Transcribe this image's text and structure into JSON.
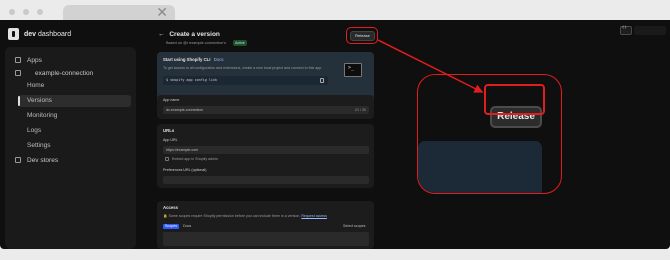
{
  "app": {
    "brand_bold": "dev",
    "brand_rest": " dashboard"
  },
  "sidebar": {
    "items": [
      {
        "label": "Apps",
        "icon": "apps-icon"
      },
      {
        "label": "example-connection",
        "icon": "app-icon"
      },
      {
        "label": "Home"
      },
      {
        "label": "Versions"
      },
      {
        "label": "Monitoring"
      },
      {
        "label": "Logs"
      },
      {
        "label": "Settings"
      },
      {
        "label": "Dev stores",
        "icon": "store-icon"
      }
    ]
  },
  "main": {
    "back_arrow": "←",
    "title": "Create a version",
    "subtitle": "Based on @r example-connection's",
    "badge": "Active",
    "release_label": "Release",
    "cli_card": {
      "title": "Start using Shopify CLI",
      "link": "Docs",
      "text": "To get access to all configuration and extensions, create a new local project and connect to this app.",
      "command": "$ shopify app config link"
    },
    "app_name": {
      "label": "App name",
      "value": "dv-example-connection",
      "counter": "21 / 30"
    },
    "urls": {
      "title": "URLs",
      "app_url_label": "App URL",
      "app_url_value": "https://example.com",
      "embed_label": "Embed app in Shopify admin",
      "preferences_label": "Preferences URL (optional)"
    },
    "access": {
      "title": "Access",
      "text": "Some scopes require Shopify permission before you can include them in a version.",
      "link": "Request access",
      "tab_scopes": "Scopes",
      "tab_docs": "Docs",
      "select_scopes": "Select scopes"
    }
  },
  "zoom": {
    "release_label": "Release"
  },
  "colors": {
    "highlight": "#e11d1d",
    "background": "#0f0f0f",
    "card": "#1c1c1c"
  }
}
